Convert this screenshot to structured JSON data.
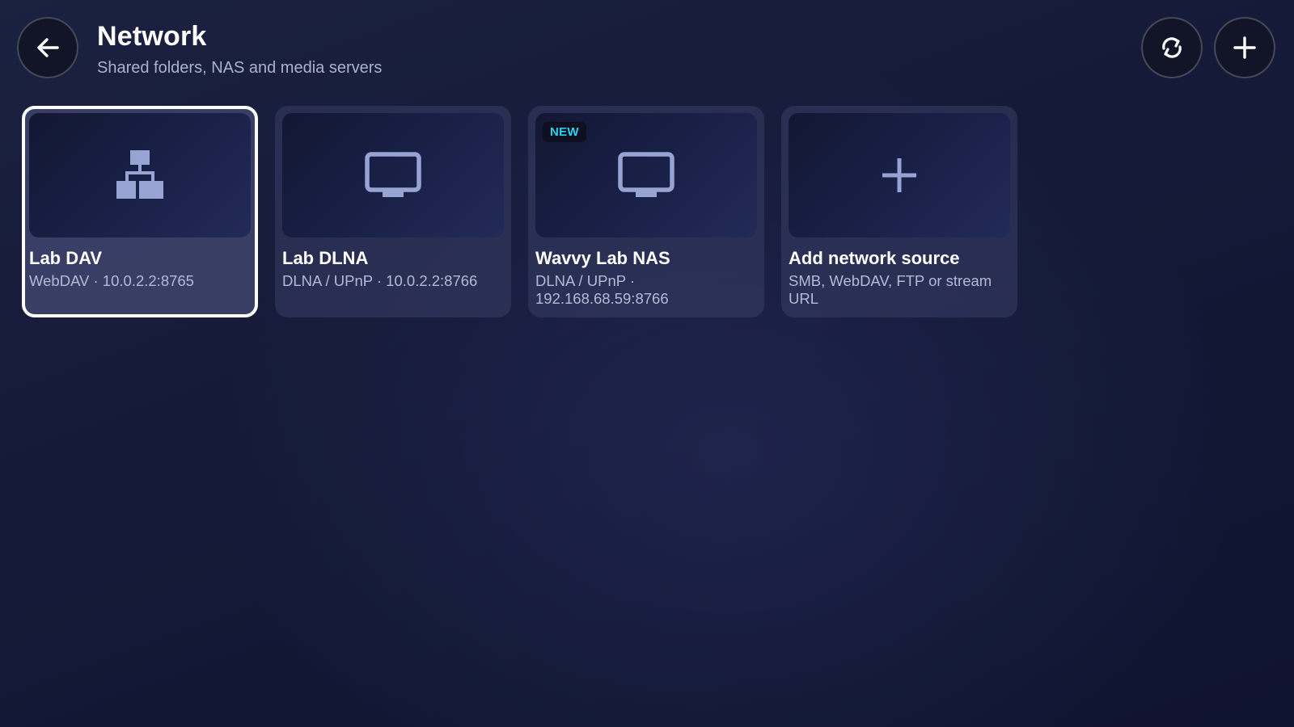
{
  "header": {
    "title": "Network",
    "subtitle": "Shared folders, NAS and media servers",
    "back_icon": "arrow-left-icon",
    "refresh_icon": "refresh-icon",
    "add_icon": "plus-icon"
  },
  "colors": {
    "badge_text": "#22d3ee",
    "icon_color": "#97a3d2",
    "selected_border": "#ffffff"
  },
  "sources": [
    {
      "title": "Lab DAV",
      "subtitle": "WebDAV · 10.0.2.2:8765",
      "icon": "network-tree-icon",
      "selected": true
    },
    {
      "title": "Lab DLNA",
      "subtitle": "DLNA / UPnP · 10.0.2.2:8766",
      "icon": "monitor-icon"
    },
    {
      "title": "Wavvy Lab NAS",
      "subtitle": "DLNA / UPnP · 192.168.68.59:8766",
      "icon": "monitor-icon",
      "badge": "NEW"
    },
    {
      "title": "Add network source",
      "subtitle": "SMB, WebDAV, FTP or stream URL",
      "icon": "plus-icon"
    }
  ]
}
